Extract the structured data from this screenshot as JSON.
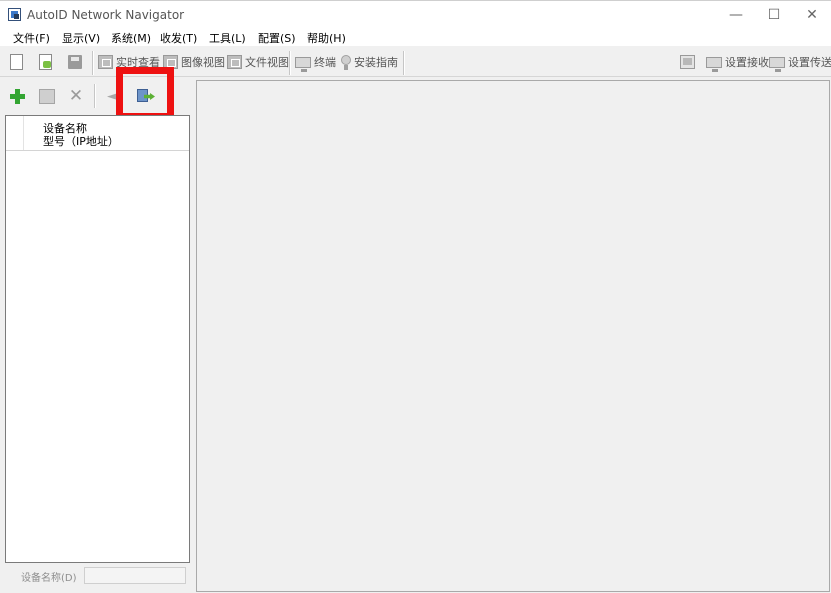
{
  "window": {
    "title": "AutoID Network Navigator",
    "minimize_glyph": "—",
    "maximize_glyph": "☐",
    "close_glyph": "✕"
  },
  "menu": [
    {
      "label": "文件(F)"
    },
    {
      "label": "显示(V)"
    },
    {
      "label": "系统(M)"
    },
    {
      "label": "收发(T)"
    },
    {
      "label": "工具(L)"
    },
    {
      "label": "配置(S)"
    },
    {
      "label": "帮助(H)"
    }
  ],
  "toolbar": {
    "realtime_view": "实时查看",
    "image_view": "图像视图",
    "file_view": "文件视图",
    "terminal": "终端",
    "install_guide": "安装指南",
    "setting_receive": "设置接收",
    "setting_send": "设置传送"
  },
  "device_list": {
    "header_line1": "设备名称",
    "header_line2": "型号（IP地址）"
  },
  "device_name": {
    "label": "设备名称(D)",
    "value": ""
  },
  "icons": {
    "new": "new-document-icon",
    "open": "open-document-icon",
    "save": "save-disk-icon",
    "add": "add-plus-icon",
    "settings": "device-settings-icon",
    "delete": "delete-x-icon",
    "back": "back-arrow-icon",
    "export": "export-arrow-icon"
  },
  "colors": {
    "highlight": "#ee1111",
    "add_green": "#33a532",
    "window_bg": "#f0f0f0"
  }
}
